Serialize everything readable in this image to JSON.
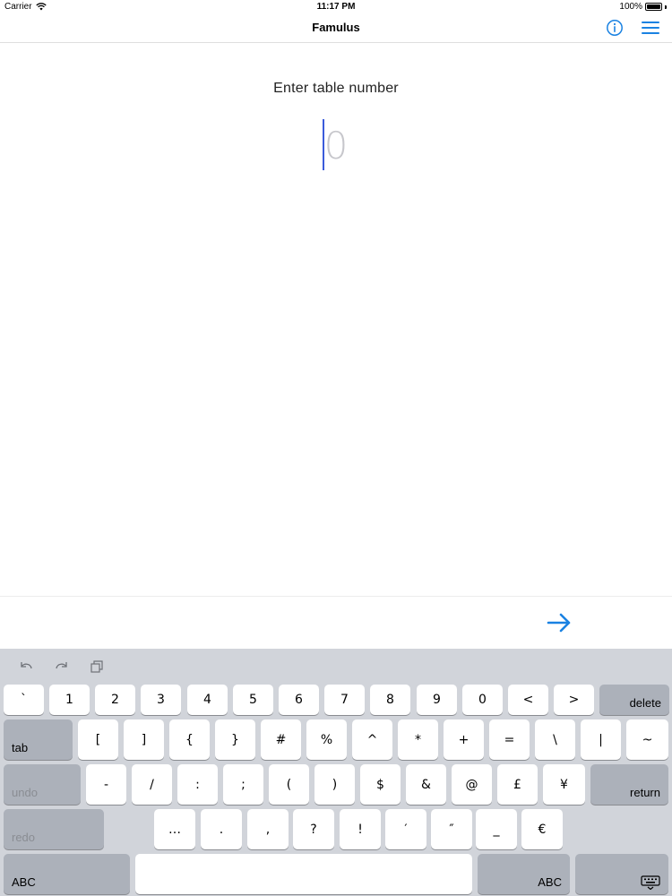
{
  "status_bar": {
    "carrier": "Carrier",
    "time": "11:17 PM",
    "battery": "100%"
  },
  "nav": {
    "title": "Famulus",
    "info_icon": "info-circle-icon",
    "menu_icon": "hamburger-menu-icon"
  },
  "main": {
    "prompt": "Enter table number",
    "input_value": "",
    "input_placeholder": "0"
  },
  "accessory": {
    "submit_icon": "arrow-right-icon"
  },
  "colors": {
    "accent": "#1a82e2",
    "keyboard_bg": "#d1d4da",
    "key_bg": "#ffffff",
    "dark_key_bg": "#acb1ba",
    "placeholder": "#c7c7cc"
  },
  "keyboard": {
    "toolbar": [
      "undo-icon",
      "redo-icon",
      "paste-icon"
    ],
    "row1": [
      "`",
      "1",
      "2",
      "3",
      "4",
      "5",
      "6",
      "7",
      "8",
      "9",
      "0",
      "<",
      ">"
    ],
    "row1_delete": "delete",
    "row2_tab": "tab",
    "row2": [
      "[",
      "]",
      "{",
      "}",
      "#",
      "%",
      "^",
      "*",
      "+",
      "=",
      "\\",
      "|",
      "~"
    ],
    "row3_undo": "undo",
    "row3": [
      "-",
      "/",
      ":",
      ";",
      "(",
      ")",
      "$",
      "&",
      "@",
      "£",
      "¥"
    ],
    "row3_return": "return",
    "row4_redo": "redo",
    "row4": [
      "…",
      ".",
      ",",
      "?",
      "!",
      "′",
      "″",
      "_",
      "€"
    ],
    "row5_abc_left": "ABC",
    "row5_abc_right": "ABC",
    "row5_dismiss_icon": "keyboard-dismiss-icon"
  }
}
